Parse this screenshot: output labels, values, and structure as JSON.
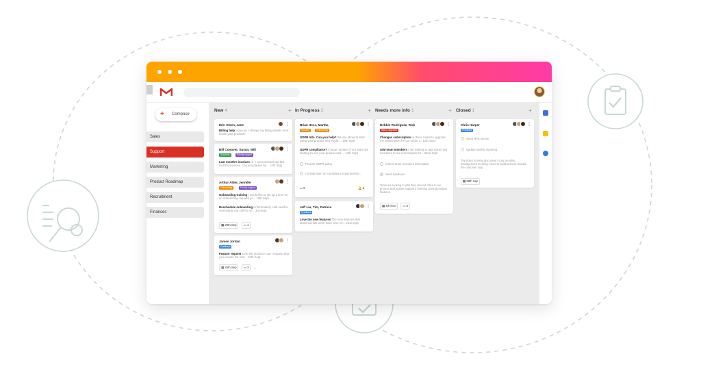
{
  "colors": {
    "accent_orange": "#fea400",
    "accent_pink": "#ff3aa8",
    "active_red": "#d93025",
    "deco_line": "#c9d8d2"
  },
  "app": {
    "logo": "gmail-logo",
    "avatar": "user-avatar"
  },
  "decorations": [
    "clipboard-check-icon",
    "inspection-magnifier-icon",
    "calendar-check-icon"
  ],
  "sidebar": {
    "compose_label": "Compose",
    "items": [
      {
        "label": "Sales",
        "active": false
      },
      {
        "label": "Support",
        "active": true
      },
      {
        "label": "Marketing",
        "active": false
      },
      {
        "label": "Product Roadmap",
        "active": false
      },
      {
        "label": "Recruitment",
        "active": false
      },
      {
        "label": "Finances",
        "active": false
      }
    ]
  },
  "columns": [
    {
      "title": "New",
      "count": "4",
      "cards": [
        {
          "who": "Erin Olsen, Jane",
          "subject": "Billing help",
          "snippet": "How can I change my billing details from inside your product?"
        },
        {
          "who": "Bill Conover, Susan, Will",
          "tags": [
            "Accounts",
            "Priority support"
          ],
          "subject": "Last month's invoices",
          "snippet": "Hi. I cannot download last months invoices. Can you please he... 14th Sept"
        },
        {
          "who": "Arthur Alder, Jennifer",
          "tags": [
            "Onboarding",
            "Priority support"
          ],
          "subject": "Onboarding training",
          "snippet": "I would like to set up a time for an onboarding call with yo... 19th Sept",
          "subject2": "Reschedule onboarding",
          "snippet2": "Unfortunately I will need to reschedule our call for ne... 3rd Sept",
          "date": "20th Sep",
          "comments": "1"
        },
        {
          "who": "James Jordan",
          "tags": [
            "Feedback"
          ],
          "subject": "Feature request",
          "snippet": "Love the product! Can I request that you include the feat... 18th Sept",
          "date": "25th Sep",
          "comments": "3"
        }
      ]
    },
    {
      "title": "In Progress",
      "count": "2",
      "cards": [
        {
          "who": "Brian Hess, Martha",
          "tags": [
            "Security",
            "Onboarding"
          ],
          "subject": "GDPR Info. Can you help?",
          "snippet": "We are about to start using your product and would ... 19th Sept",
          "subject2": "GDPR compliance?",
          "snippet2": "A large number of our team are starting to use your product and ... 14th Sept",
          "tasks": [
            "Provide GDPR policy",
            "Consult team on compliance requirements..."
          ],
          "comments": "5",
          "bell": "3"
        },
        {
          "who": "Jeff Liu, Tim, Patricia",
          "tags": [
            "Feedback"
          ],
          "subject": "Love the new features",
          "snippet": "The new features that launched last week have been re... 21st Sept"
        }
      ]
    },
    {
      "title": "Needs more info",
      "count": "1",
      "cards": [
        {
          "who": "Debbie Rodriguez, Rick",
          "tags": [
            "Billing upgrades"
          ],
          "subject": "Changes subscription",
          "snippet": "Hi there I want to upgrade my subscription for our entire t... 12th Sept",
          "subject2": "Add team members",
          "snippet2": "I am looking to add some new members to our current plan thr... 22nd Sept",
          "tasks": [
            "Collect team members information",
            "Send handover"
          ],
          "note": "Team are looking to add their second office to our product and require support in training around product features.",
          "date": "4th Nov",
          "comments": "6"
        }
      ]
    },
    {
      "title": "Closed",
      "count": "1",
      "cards": [
        {
          "who": "Chris Harper",
          "tags": [
            "Feedback"
          ],
          "tasks": [
            "Send NPS survey",
            "Update weekly reporting"
          ],
          "note": "The ticket is being discussed in our monthly management meeting. Need to build process around the customer loop.",
          "date": "28th Sep"
        }
      ]
    }
  ]
}
